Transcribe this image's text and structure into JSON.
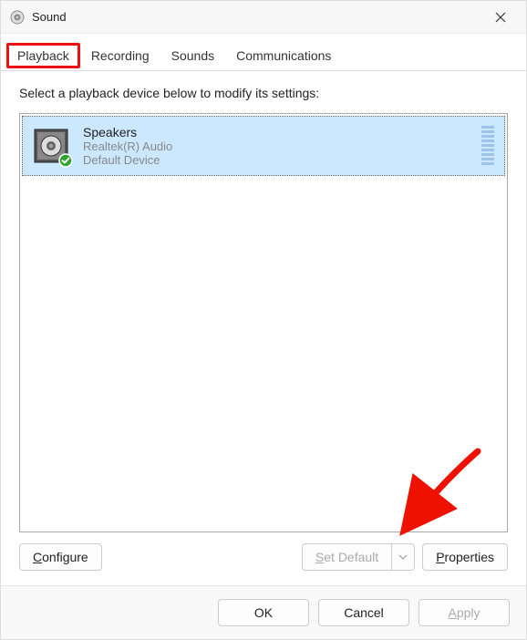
{
  "window": {
    "title": "Sound"
  },
  "tabs": {
    "playback": "Playback",
    "recording": "Recording",
    "sounds": "Sounds",
    "communications": "Communications"
  },
  "content": {
    "instruction": "Select a playback device below to modify its settings:"
  },
  "device": {
    "name": "Speakers",
    "driver": "Realtek(R) Audio",
    "status": "Default Device"
  },
  "buttons": {
    "configure_prefix": "C",
    "configure_rest": "onfigure",
    "set_default_prefix": "S",
    "set_default_rest": "et Default",
    "properties_prefix": "P",
    "properties_rest": "roperties",
    "ok": "OK",
    "cancel": "Cancel",
    "apply_prefix": "A",
    "apply_rest": "pply"
  }
}
